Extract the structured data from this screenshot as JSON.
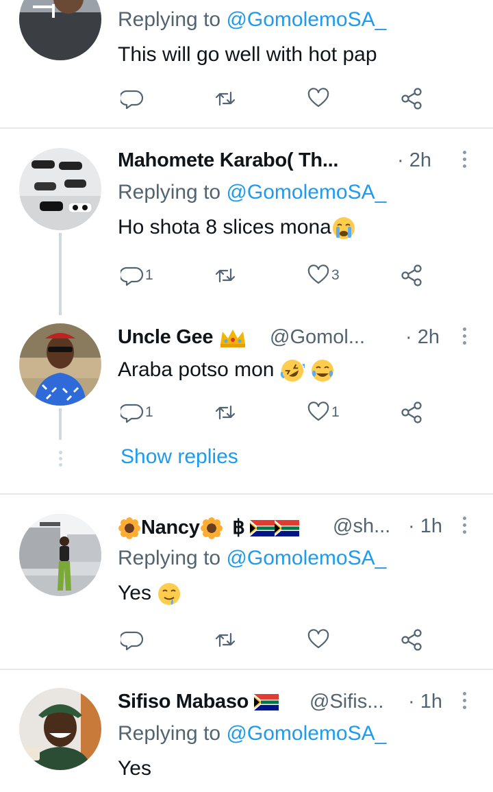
{
  "tweets": [
    {
      "name": "",
      "handle": "",
      "time": "",
      "replying_prefix": "Replying to ",
      "replying_handle": "@GomolemoSA_",
      "text": "This will go well with hot pap",
      "reply_count": "",
      "like_count": ""
    },
    {
      "name": "Mahomete Karabo( Th...",
      "handle": "",
      "time": "· 2h",
      "replying_prefix": "Replying to ",
      "replying_handle": "@GomolemoSA_",
      "text": "Ho shota 8 slices mona",
      "reply_count": "1",
      "like_count": "3"
    },
    {
      "name": "Uncle Gee",
      "handle": "@Gomol...",
      "time": "· 2h",
      "text": "Araba potso mon",
      "reply_count": "1",
      "like_count": "1"
    },
    {
      "name": "Nancy",
      "handle": "@sh...",
      "time": "· 1h",
      "replying_prefix": "Replying to ",
      "replying_handle": "@GomolemoSA_",
      "text": "Yes",
      "reply_count": "",
      "like_count": ""
    },
    {
      "name": "Sifiso Mabaso",
      "handle": "@Sifis...",
      "time": "· 1h",
      "replying_prefix": "Replying to ",
      "replying_handle": "@GomolemoSA_",
      "text": "Yes"
    }
  ],
  "show_replies_label": "Show replies",
  "baht_symbol": "฿",
  "icons": [
    "reply-icon",
    "retweet-icon",
    "like-icon",
    "share-icon",
    "more-icon",
    "crown-icon",
    "sunflower-icon",
    "south-africa-flag-icon",
    "crying-face-icon",
    "rofl-icon",
    "tears-of-joy-icon",
    "drooling-face-icon"
  ],
  "colors": {
    "link": "#1d9bf0",
    "secondary": "#536471",
    "divider": "#e6e9ec",
    "thread": "#cfd9de"
  }
}
